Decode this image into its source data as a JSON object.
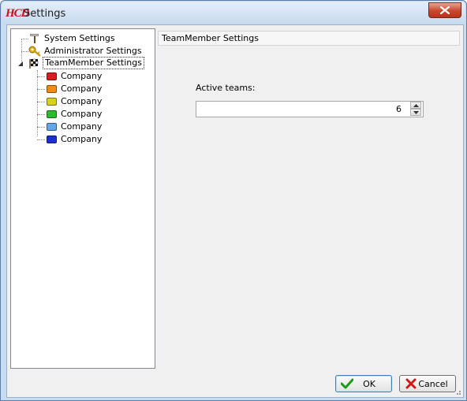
{
  "window": {
    "logo_text": "HCD",
    "title": "Settings"
  },
  "tree": {
    "items": [
      {
        "label": "System Settings",
        "icon": "hammer-wrench-icon"
      },
      {
        "label": "Administrator Settings",
        "icon": "keys-icon"
      },
      {
        "label": "TeamMember Settings",
        "icon": "checkered-flag-icon",
        "expanded": true,
        "selected": true
      }
    ],
    "teams": [
      {
        "label": "Company",
        "color": "#d81e1e"
      },
      {
        "label": "Company",
        "color": "#f08c14"
      },
      {
        "label": "Company",
        "color": "#d6d21e"
      },
      {
        "label": "Company",
        "color": "#2cbb2c"
      },
      {
        "label": "Company",
        "color": "#62a7e8"
      },
      {
        "label": "Company",
        "color": "#1b2fd0"
      }
    ]
  },
  "panel": {
    "header": "TeamMember Settings",
    "active_teams_label": "Active teams:",
    "active_teams_value": "6"
  },
  "buttons": {
    "ok": "OK",
    "cancel": "Cancel"
  }
}
